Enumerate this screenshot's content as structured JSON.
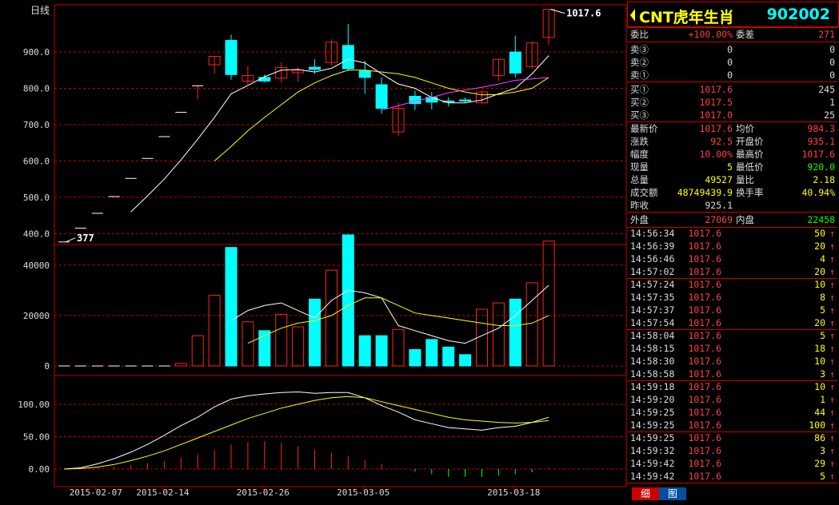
{
  "chart": {
    "period_label": "日线",
    "price_ticks": [
      "900.0",
      "800.0",
      "700.0",
      "600.0",
      "500.0",
      "400.0"
    ],
    "volume_ticks": [
      "40000",
      "20000",
      "0"
    ],
    "indicator_ticks": [
      "100.00",
      "50.00",
      "0.00"
    ],
    "date_labels": [
      "2015-02-07",
      "2015-02-14",
      "2015-02-26",
      "2015-03-05",
      "2015-03-18"
    ],
    "annotation_high": "1017.6",
    "annotation_low": "377",
    "colors": {
      "up": "#ff2020",
      "down": "#00ffff",
      "ma5": "#ffffff",
      "ma10": "#ffff00",
      "ma20": "#ff40ff",
      "grid": "#c00000"
    }
  },
  "chart_data": {
    "type": "candlestick",
    "price_ylim": [
      370,
      1030
    ],
    "volume_ylim": [
      0,
      45000
    ],
    "indicator_ylim": [
      -8,
      132
    ],
    "candles": [
      {
        "o": 377,
        "h": 377,
        "l": 377,
        "c": 377,
        "v": 0
      },
      {
        "o": 415,
        "h": 415,
        "l": 415,
        "c": 415,
        "v": 0
      },
      {
        "o": 456,
        "h": 456,
        "l": 456,
        "c": 456,
        "v": 0
      },
      {
        "o": 502,
        "h": 502,
        "l": 502,
        "c": 502,
        "v": 0
      },
      {
        "o": 552,
        "h": 552,
        "l": 552,
        "c": 552,
        "v": 0
      },
      {
        "o": 607,
        "h": 607,
        "l": 607,
        "c": 607,
        "v": 0
      },
      {
        "o": 667,
        "h": 667,
        "l": 667,
        "c": 667,
        "v": 0
      },
      {
        "o": 734,
        "h": 734,
        "l": 734,
        "c": 734,
        "v": 1000
      },
      {
        "o": 807,
        "h": 807,
        "l": 770,
        "c": 807,
        "v": 12000
      },
      {
        "o": 865,
        "h": 888,
        "l": 840,
        "c": 888,
        "v": 28000
      },
      {
        "o": 932,
        "h": 948,
        "l": 824,
        "c": 838,
        "v": 47000
      },
      {
        "o": 820,
        "h": 862,
        "l": 810,
        "c": 835,
        "v": 17500
      },
      {
        "o": 830,
        "h": 838,
        "l": 816,
        "c": 820,
        "v": 14000
      },
      {
        "o": 828,
        "h": 872,
        "l": 815,
        "c": 857,
        "v": 20500
      },
      {
        "o": 843,
        "h": 857,
        "l": 818,
        "c": 850,
        "v": 15500
      },
      {
        "o": 858,
        "h": 880,
        "l": 840,
        "c": 852,
        "v": 26500
      },
      {
        "o": 871,
        "h": 935,
        "l": 862,
        "c": 927,
        "v": 38000
      },
      {
        "o": 918,
        "h": 977,
        "l": 848,
        "c": 854,
        "v": 52000
      },
      {
        "o": 848,
        "h": 876,
        "l": 785,
        "c": 830,
        "v": 12000
      },
      {
        "o": 810,
        "h": 830,
        "l": 730,
        "c": 745,
        "v": 12000
      },
      {
        "o": 680,
        "h": 760,
        "l": 670,
        "c": 745,
        "v": 14500
      },
      {
        "o": 778,
        "h": 794,
        "l": 740,
        "c": 758,
        "v": 6500
      },
      {
        "o": 775,
        "h": 790,
        "l": 742,
        "c": 762,
        "v": 10500
      },
      {
        "o": 765,
        "h": 775,
        "l": 750,
        "c": 762,
        "v": 7500
      },
      {
        "o": 768,
        "h": 775,
        "l": 760,
        "c": 765,
        "v": 4500
      },
      {
        "o": 760,
        "h": 795,
        "l": 758,
        "c": 790,
        "v": 22500
      },
      {
        "o": 835,
        "h": 880,
        "l": 820,
        "c": 880,
        "v": 25000
      },
      {
        "o": 900,
        "h": 945,
        "l": 830,
        "c": 842,
        "v": 26500
      },
      {
        "o": 860,
        "h": 930,
        "l": 855,
        "c": 925,
        "v": 33000
      },
      {
        "o": 940,
        "h": 1017.6,
        "l": 920,
        "c": 1017.6,
        "v": 49527
      }
    ],
    "ma5": [
      null,
      null,
      null,
      null,
      460,
      504,
      550,
      603,
      660,
      720,
      785,
      808,
      832,
      850,
      852,
      845,
      855,
      880,
      870,
      840,
      812,
      800,
      775,
      760,
      760,
      768,
      785,
      800,
      840,
      890
    ],
    "ma10": [
      null,
      null,
      null,
      null,
      null,
      null,
      null,
      null,
      null,
      600,
      640,
      683,
      720,
      755,
      790,
      815,
      835,
      850,
      850,
      845,
      840,
      830,
      815,
      800,
      790,
      782,
      783,
      790,
      800,
      830
    ],
    "ma20": [
      null,
      null,
      null,
      null,
      null,
      null,
      null,
      null,
      null,
      null,
      null,
      null,
      null,
      null,
      null,
      null,
      null,
      null,
      null,
      740,
      752,
      765,
      775,
      788,
      795,
      803,
      812,
      822,
      826,
      830
    ],
    "vol_ma5": [
      null,
      null,
      null,
      null,
      null,
      null,
      null,
      null,
      null,
      null,
      18000,
      22000,
      24000,
      25000,
      22000,
      19000,
      26000,
      30000,
      29000,
      27000,
      16000,
      14000,
      12000,
      10000,
      9000,
      12000,
      15000,
      20000,
      26000,
      32000
    ],
    "vol_ma10": [
      null,
      null,
      null,
      null,
      null,
      null,
      null,
      null,
      null,
      null,
      null,
      9000,
      12000,
      15000,
      17000,
      18000,
      20000,
      24000,
      27000,
      27000,
      24000,
      21000,
      20000,
      19000,
      18000,
      17000,
      16000,
      16000,
      17000,
      20000
    ],
    "ind_bars": [
      0,
      1,
      2,
      4,
      6,
      9,
      12,
      17,
      23,
      30,
      38,
      42,
      43,
      40,
      35,
      30,
      25,
      20,
      14,
      8,
      1,
      -4,
      -8,
      -12,
      -12,
      -12,
      -10,
      -8,
      -5,
      2
    ],
    "ind_line1": [
      0,
      2,
      8,
      16,
      26,
      38,
      52,
      67,
      80,
      96,
      108,
      113,
      116,
      118,
      119,
      117,
      118,
      118,
      110,
      98,
      88,
      76,
      70,
      64,
      62,
      60,
      64,
      66,
      72,
      80
    ],
    "ind_line2": [
      0,
      1,
      3,
      7,
      13,
      20,
      28,
      38,
      48,
      58,
      68,
      78,
      86,
      94,
      100,
      106,
      110,
      112,
      110,
      104,
      98,
      92,
      86,
      80,
      76,
      74,
      72,
      71,
      72,
      75
    ]
  },
  "panel": {
    "stock_name": "CNT虎年生肖",
    "stock_code": "902002",
    "weibi_label": "委比",
    "weibi_value": "+100.00%",
    "weicha_label": "委差",
    "weicha_value": "271",
    "sells": [
      {
        "label": "卖③",
        "price": "0",
        "vol": "0"
      },
      {
        "label": "卖②",
        "price": "0",
        "vol": "0"
      },
      {
        "label": "卖①",
        "price": "0",
        "vol": "0"
      }
    ],
    "buys": [
      {
        "label": "买①",
        "price": "1017.6",
        "vol": "245"
      },
      {
        "label": "买②",
        "price": "1017.5",
        "vol": "1"
      },
      {
        "label": "买③",
        "price": "1017.0",
        "vol": "25"
      }
    ],
    "stats": [
      {
        "l1": "最新价",
        "v1": "1017.6",
        "c1": "red",
        "l2": "均价",
        "v2": "984.3",
        "c2": "red"
      },
      {
        "l1": "涨跌",
        "v1": "92.5",
        "c1": "red",
        "l2": "开盘价",
        "v2": "935.1",
        "c2": "red"
      },
      {
        "l1": "幅度",
        "v1": "10.00%",
        "c1": "red",
        "l2": "最高价",
        "v2": "1017.6",
        "c2": "red"
      },
      {
        "l1": "现量",
        "v1": "5",
        "c1": "yel",
        "l2": "最低价",
        "v2": "920.0",
        "c2": "grn"
      },
      {
        "l1": "总量",
        "v1": "49527",
        "c1": "yel",
        "l2": "量比",
        "v2": "2.18",
        "c2": "yel"
      },
      {
        "l1": "成交额",
        "v1": "48749439.9",
        "c1": "yel",
        "l2": "换手率",
        "v2": "40.94%",
        "c2": "yel"
      },
      {
        "l1": "昨收",
        "v1": "925.1",
        "c1": "wht",
        "l2": "",
        "v2": "",
        "c2": "wht"
      }
    ],
    "outer_label": "外盘",
    "outer_value": "27069",
    "inner_label": "内盘",
    "inner_value": "22458",
    "ticks": [
      {
        "time": "14:56:34",
        "price": "1017.6",
        "vol": "50"
      },
      {
        "time": "14:56:39",
        "price": "1017.6",
        "vol": "20"
      },
      {
        "time": "14:56:46",
        "price": "1017.6",
        "vol": "4"
      },
      {
        "time": "14:57:02",
        "price": "1017.6",
        "vol": "20"
      },
      {
        "time": "14:57:24",
        "price": "1017.6",
        "vol": "10"
      },
      {
        "time": "14:57:35",
        "price": "1017.6",
        "vol": "8"
      },
      {
        "time": "14:57:37",
        "price": "1017.6",
        "vol": "5"
      },
      {
        "time": "14:57:54",
        "price": "1017.6",
        "vol": "20"
      },
      {
        "time": "14:58:04",
        "price": "1017.6",
        "vol": "5"
      },
      {
        "time": "14:58:15",
        "price": "1017.6",
        "vol": "18"
      },
      {
        "time": "14:58:30",
        "price": "1017.6",
        "vol": "10"
      },
      {
        "time": "14:58:58",
        "price": "1017.6",
        "vol": "3"
      },
      {
        "time": "14:59:18",
        "price": "1017.6",
        "vol": "10"
      },
      {
        "time": "14:59:20",
        "price": "1017.6",
        "vol": "1"
      },
      {
        "time": "14:59:25",
        "price": "1017.6",
        "vol": "44"
      },
      {
        "time": "14:59:25",
        "price": "1017.6",
        "vol": "100"
      },
      {
        "time": "14:59:25",
        "price": "1017.6",
        "vol": "86"
      },
      {
        "time": "14:59:32",
        "price": "1017.6",
        "vol": "3"
      },
      {
        "time": "14:59:42",
        "price": "1017.6",
        "vol": "29"
      },
      {
        "time": "14:59:42",
        "price": "1017.6",
        "vol": "5"
      }
    ],
    "tick_arrow": "↑",
    "tab_detail": "细",
    "tab_chart": "图"
  }
}
